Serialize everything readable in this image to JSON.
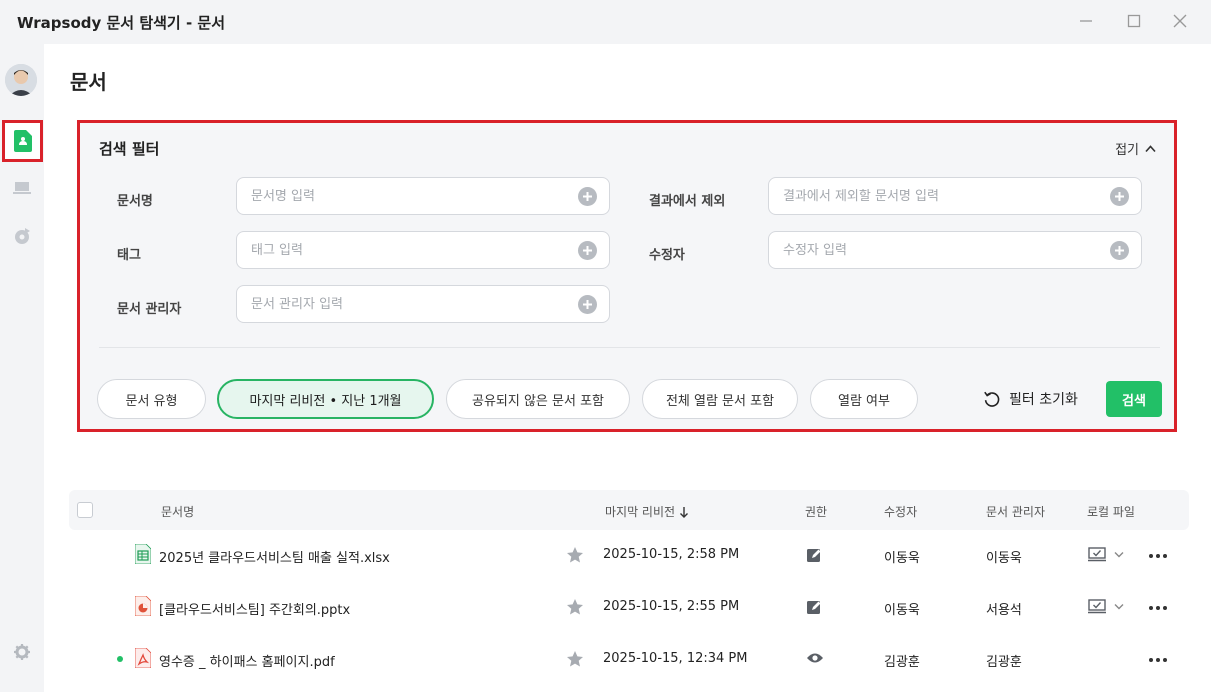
{
  "window": {
    "title": "Wrapsody 문서 탐색기 - 문서"
  },
  "page": {
    "title": "문서"
  },
  "filter": {
    "title": "검색 필터",
    "collapse_label": "접기",
    "fields": {
      "doc_name": {
        "label": "문서명",
        "placeholder": "문서명 입력"
      },
      "exclude": {
        "label": "결과에서 제외",
        "placeholder": "결과에서 제외할 문서명 입력"
      },
      "tag": {
        "label": "태그",
        "placeholder": "태그 입력"
      },
      "modifier": {
        "label": "수정자",
        "placeholder": "수정자 입력"
      },
      "manager": {
        "label": "문서 관리자",
        "placeholder": "문서 관리자 입력"
      }
    },
    "chips": {
      "doc_type": "문서 유형",
      "last_revision": "마지막 리비전 • 지난 1개월",
      "include_unshared": "공유되지 않은 문서 포함",
      "include_all_view": "전체 열람 문서 포함",
      "read_status": "열람 여부"
    },
    "reset_label": "필터 초기화",
    "search_label": "검색"
  },
  "table": {
    "headers": {
      "name": "문서명",
      "last_revision": "마지막 리비전",
      "permission": "권한",
      "modifier": "수정자",
      "manager": "문서 관리자",
      "local_file": "로컬 파일"
    },
    "rows": [
      {
        "name": "2025년 클라우드서비스팀 매출 실적.xlsx",
        "type": "xlsx",
        "revision": "2025-10-15, 2:58 PM",
        "permission": "edit",
        "modifier": "이동욱",
        "manager": "이동욱",
        "local": true,
        "unread": false
      },
      {
        "name": "[클라우드서비스팀] 주간회의.pptx",
        "type": "pptx",
        "revision": "2025-10-15, 2:55 PM",
        "permission": "edit",
        "modifier": "이동욱",
        "manager": "서용석",
        "local": true,
        "unread": false
      },
      {
        "name": "영수증 _ 하이패스 홈페이지.pdf",
        "type": "pdf",
        "revision": "2025-10-15, 12:34 PM",
        "permission": "view",
        "modifier": "김광훈",
        "manager": "김광훈",
        "local": false,
        "unread": true
      }
    ]
  },
  "colors": {
    "accent_green": "#22c067",
    "highlight_red": "#d9222a",
    "xlsx_green": "#1f9d55",
    "pptx_red": "#e0533a",
    "pdf_red": "#e2483b"
  }
}
